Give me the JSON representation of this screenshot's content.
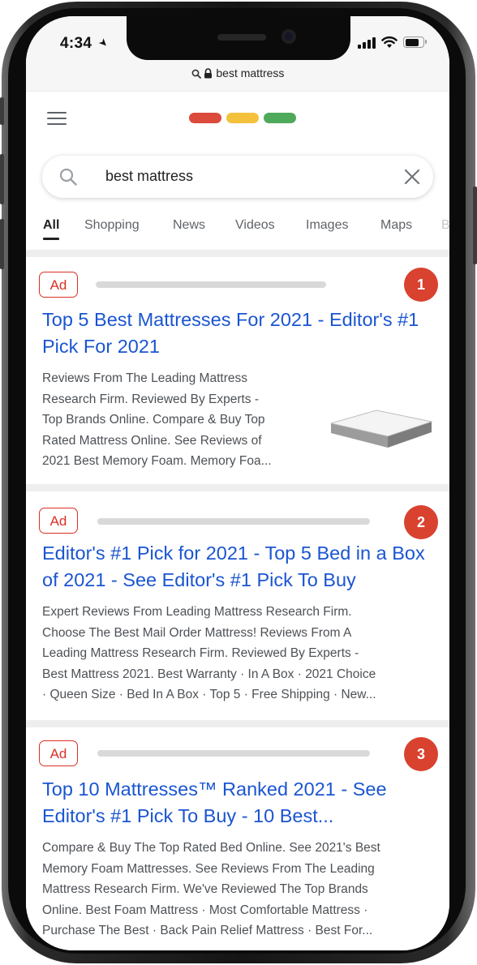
{
  "status_bar": {
    "time": "4:34",
    "battery_level": 0.8
  },
  "browser": {
    "url": "best mattress"
  },
  "google": {
    "logo_colors": [
      "#db4a3b",
      "#f4c13d",
      "#4fa95a"
    ]
  },
  "search": {
    "query": "best mattress"
  },
  "tabs": [
    {
      "label": "All",
      "active": true
    },
    {
      "label": "Shopping"
    },
    {
      "label": "News"
    },
    {
      "label": "Videos"
    },
    {
      "label": "Images"
    },
    {
      "label": "Maps"
    },
    {
      "label": "B"
    }
  ],
  "results": [
    {
      "badge": "Ad",
      "rank": "1",
      "title": "Top 5 Best Mattresses For 2021 - Editor's #1 Pick For 2021",
      "snippet_lines": [
        "Reviews From The Leading Mattress",
        "Research Firm. Reviewed By Experts -",
        "Top Brands Online. Compare & Buy Top",
        "Rated Mattress Online. See Reviews of",
        "2021 Best Memory Foam. Memory Foa..."
      ],
      "image": "mattress-image"
    },
    {
      "badge": "Ad",
      "rank": "2",
      "title": "Editor's #1 Pick for 2021 - Top 5 Bed in a Box of 2021 - See Editor's #1 Pick To Buy",
      "snippet_lines": [
        "Expert Reviews From Leading Mattress Research Firm.",
        "Choose The Best Mail Order Mattress! Reviews From A",
        "Leading Mattress Research Firm. Reviewed By Experts -",
        "Best Mattress 2021. Best Warranty · In A Box · 2021 Choice",
        "· Queen Size · Bed In A Box · Top 5 · Free Shipping · New..."
      ]
    },
    {
      "badge": "Ad",
      "rank": "3",
      "title": "Top 10 Mattresses™ Ranked 2021 - See Editor's #1 Pick To Buy - 10 Best...",
      "snippet_lines": [
        "Compare & Buy The Top Rated Bed Online. See 2021's Best",
        "Memory Foam Mattresses. See Reviews From The Leading",
        "Mattress Research Firm. We've Reviewed The Top Brands",
        "Online. Best Foam Mattress · Most Comfortable Mattress ·",
        "Purchase The Best · Back Pain Relief Mattress · Best For..."
      ]
    }
  ],
  "colors": {
    "link_blue": "#1a55d1",
    "ad_red": "#d93025",
    "rank_badge": "#d8422f",
    "snippet_gray": "#4d5156"
  }
}
